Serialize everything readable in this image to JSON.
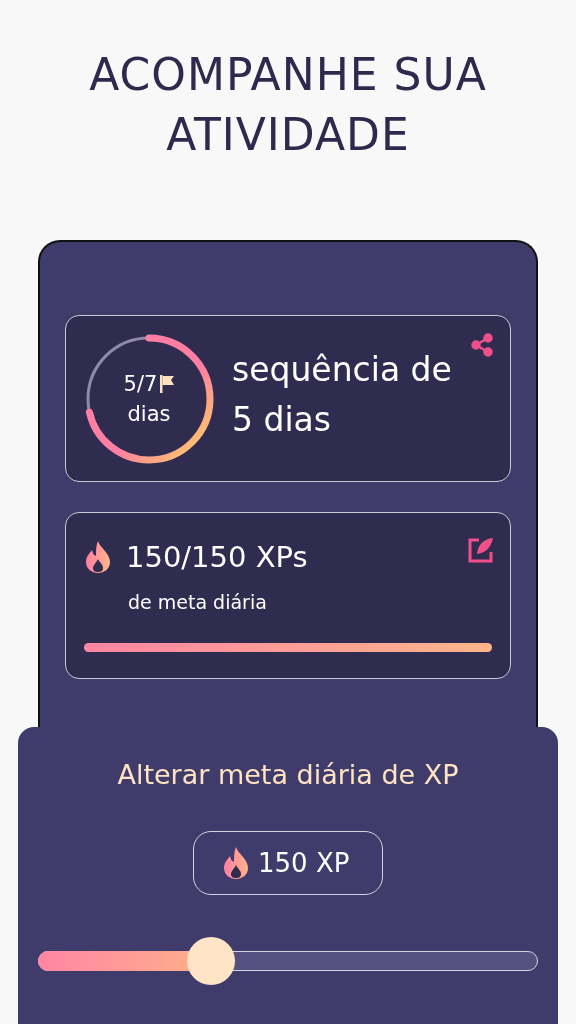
{
  "headline": [
    "ACOMPANHE SUA",
    "ATIVIDADE"
  ],
  "streak_card": {
    "ring_count": "5/7",
    "ring_unit": "dias",
    "level": 0.714,
    "title_lines": [
      "sequência de",
      "5 dias"
    ]
  },
  "goal_card": {
    "xp": "150/150 XPs",
    "subtitle": "de meta diária",
    "level": 1
  },
  "goal_sheet": {
    "title": "Alterar meta diária de XP",
    "value": "150 XP",
    "slider": {
      "level": 0.345
    }
  }
}
